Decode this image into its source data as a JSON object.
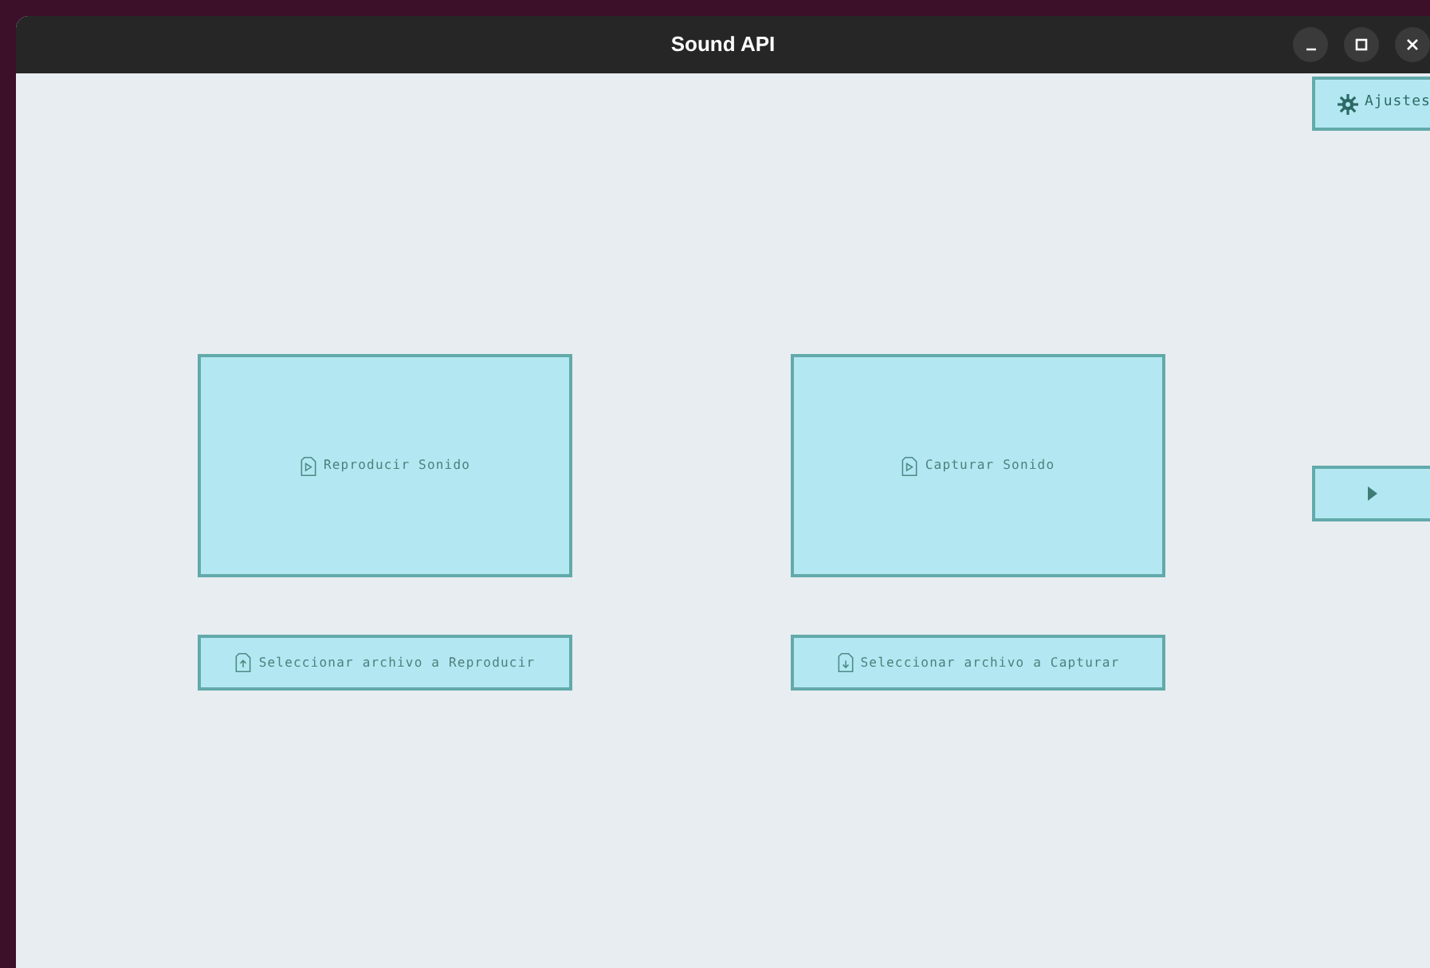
{
  "window": {
    "title": "Sound API",
    "controls": [
      {
        "kind": "minimize"
      },
      {
        "kind": "maximize"
      },
      {
        "kind": "close"
      }
    ]
  },
  "settings_button": {
    "label": "Ajustes"
  },
  "actions": [
    {
      "label": "Reproducir Sonido",
      "kind": "play"
    },
    {
      "label": "Capturar Sonido",
      "kind": "play"
    }
  ],
  "file_actions": [
    {
      "label": "Seleccionar archivo a Reproducir",
      "kind": "upload"
    },
    {
      "label": "Seleccionar archivo a Capturar",
      "kind": "download"
    }
  ],
  "next_button": {
    "kind": "next"
  }
}
